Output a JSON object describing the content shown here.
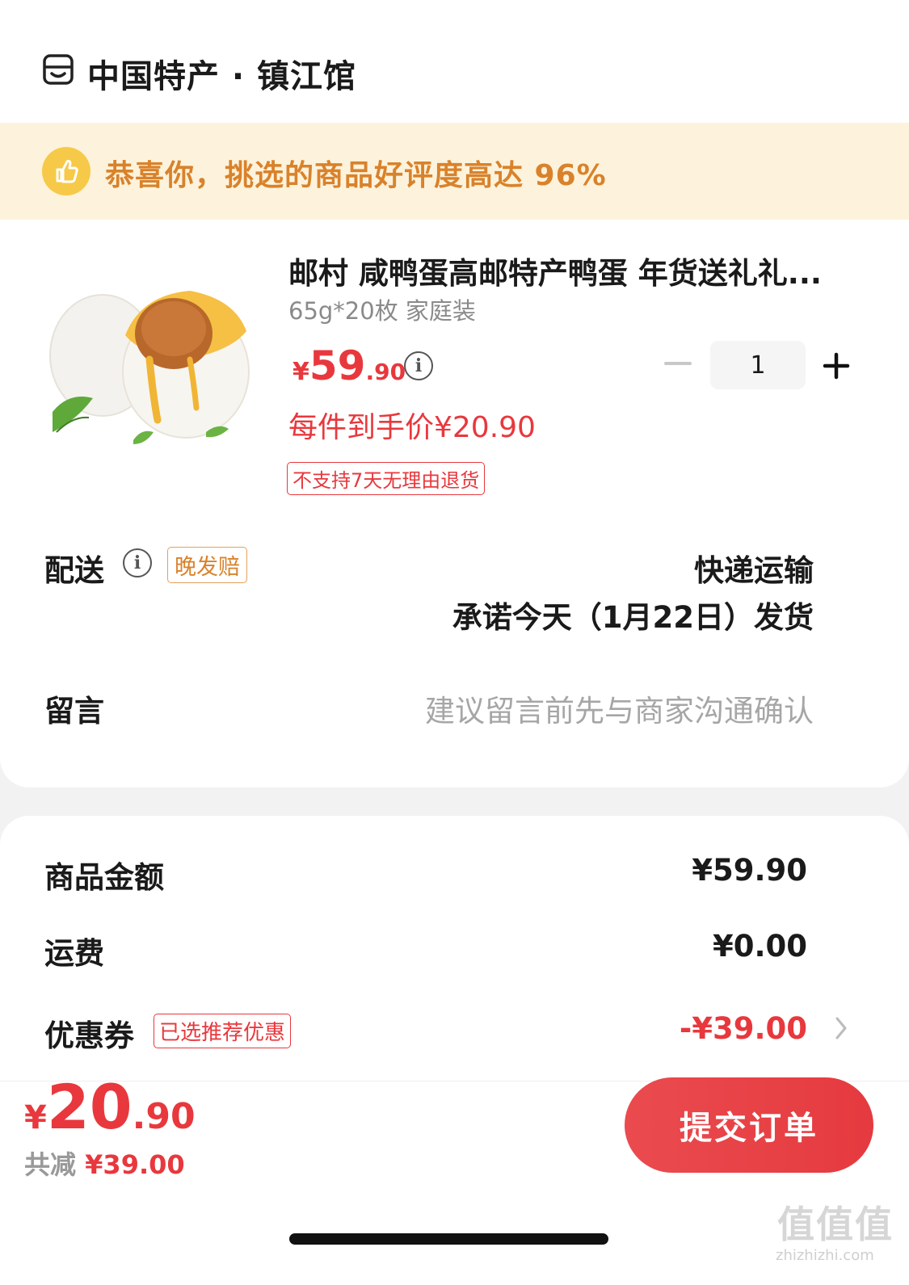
{
  "header": {
    "shop_name": "中国特产 · 镇江馆"
  },
  "banner": {
    "text": "恭喜你，挑选的商品好评度高达 96%"
  },
  "product": {
    "title": "邮村 咸鸭蛋高邮特产鸭蛋 年货送礼礼...",
    "spec": "65g*20枚 家庭装",
    "price_symbol": "¥",
    "price_int": "59",
    "price_dec": ".90",
    "hand_price": "每件到手价¥20.90",
    "return_tag": "不支持7天无理由退货",
    "quantity": "1"
  },
  "delivery": {
    "label": "配送",
    "tag": "晚发赔",
    "method": "快递运输",
    "promise": "承诺今天（1月22日）发货"
  },
  "message": {
    "label": "留言",
    "placeholder": "建议留言前先与商家沟通确认"
  },
  "summary": {
    "goods_label": "商品金额",
    "goods_value": "¥59.90",
    "shipping_label": "运费",
    "shipping_value": "¥0.00",
    "coupon_label": "优惠券",
    "coupon_tag": "已选推荐优惠",
    "coupon_value": "-¥39.00"
  },
  "footer": {
    "total_symbol": "¥",
    "total_int": "20",
    "total_dec": ".90",
    "discount_label": "共减",
    "discount_value": "¥39.00",
    "submit_label": "提交订单"
  },
  "watermark": {
    "main": "值值值",
    "sub": "zhizhizhi.com"
  },
  "colors": {
    "accent_red": "#e8383d",
    "banner_bg": "#fdf3dc",
    "banner_text": "#d9822b"
  }
}
